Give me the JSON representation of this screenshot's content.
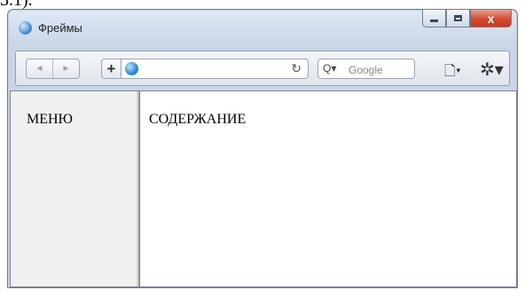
{
  "caption_fragment": "3.1).",
  "window": {
    "title": "Фреймы",
    "controls": {
      "close_label": "x"
    }
  },
  "toolbar": {
    "back_label": "◄",
    "forward_label": "►",
    "add_label": "+",
    "address_value": "",
    "reload_glyph": "↻",
    "search_placeholder": "Google",
    "search_glyph": "Q▾",
    "page_menu_glyph": "🗋▾",
    "tools_menu_glyph": "✲▾"
  },
  "frames": {
    "menu_text": "МЕНЮ",
    "content_text": "СОДЕРЖАНИЕ"
  },
  "icons": {
    "title_icon": "safari-compass-icon",
    "address_icon": "globe-icon"
  }
}
